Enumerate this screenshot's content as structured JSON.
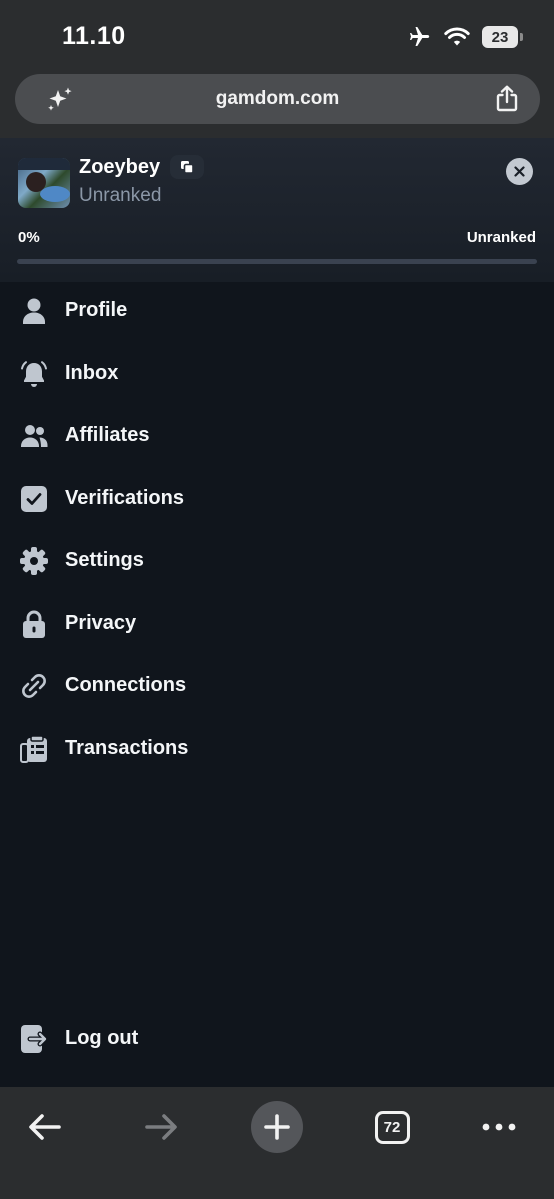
{
  "status": {
    "time": "11.10",
    "battery": "23"
  },
  "browser": {
    "url": "gamdom.com",
    "tab_count": "72"
  },
  "user": {
    "name": "Zoeybey",
    "rank": "Unranked"
  },
  "progress": {
    "percent_label": "0%",
    "fraction": 0.0,
    "rank_label": "Unranked"
  },
  "menu": {
    "items": [
      {
        "label": "Profile",
        "icon": "person-icon"
      },
      {
        "label": "Inbox",
        "icon": "bell-icon"
      },
      {
        "label": "Affiliates",
        "icon": "people-icon"
      },
      {
        "label": "Verifications",
        "icon": "checkbox-icon"
      },
      {
        "label": "Settings",
        "icon": "gear-icon"
      },
      {
        "label": "Privacy",
        "icon": "lock-icon"
      },
      {
        "label": "Connections",
        "icon": "link-icon"
      },
      {
        "label": "Transactions",
        "icon": "clipboard-list-icon"
      }
    ],
    "logout_label": "Log out"
  },
  "colors": {
    "background": "#10151c",
    "icon_grey": "#bfc6cf",
    "browser_chrome": "#2b2d2f"
  }
}
